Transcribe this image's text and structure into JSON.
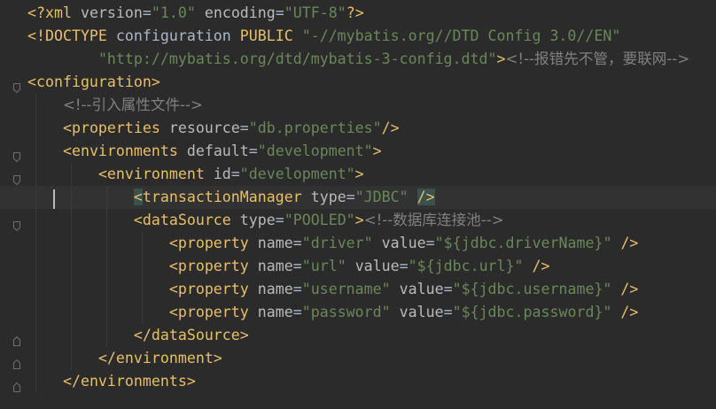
{
  "editor": {
    "language": "xml",
    "colors": {
      "background": "#2b2b2b",
      "tag": "#e8bf6a",
      "attribute": "#bababa",
      "value": "#6a8759",
      "comment": "#808080",
      "keyword": "#cc7832",
      "current_line": "#323232",
      "brace_match": "#3b514d"
    },
    "lines": [
      {
        "tokens": [
          {
            "t": "<?xml ",
            "c": "pi"
          },
          {
            "t": "version",
            "c": "attr"
          },
          {
            "t": "=",
            "c": "plain"
          },
          {
            "t": "\"1.0\"",
            "c": "val"
          },
          {
            "t": " ",
            "c": "plain"
          },
          {
            "t": "encoding",
            "c": "attr"
          },
          {
            "t": "=",
            "c": "plain"
          },
          {
            "t": "\"UTF-8\"",
            "c": "val"
          },
          {
            "t": "?>",
            "c": "pi"
          }
        ]
      },
      {
        "tokens": [
          {
            "t": "<!DOCTYPE ",
            "c": "doc"
          },
          {
            "t": "configuration ",
            "c": "plain"
          },
          {
            "t": "PUBLIC ",
            "c": "doc"
          },
          {
            "t": "\"-//mybatis.org//DTD Config 3.0//EN\"",
            "c": "val"
          }
        ]
      },
      {
        "tokens": [
          {
            "t": "        ",
            "c": "plain"
          },
          {
            "t": "\"http://mybatis.org/dtd/mybatis-3-config.dtd\"",
            "c": "val"
          },
          {
            "t": ">",
            "c": "doc"
          },
          {
            "t": "<!--报错先不管，要联网-->",
            "c": "com"
          }
        ]
      },
      {
        "tokens": [
          {
            "t": "<configuration>",
            "c": "tag"
          }
        ]
      },
      {
        "tokens": [
          {
            "t": "    ",
            "c": "plain"
          },
          {
            "t": "<!--引入属性文件-->",
            "c": "com"
          }
        ]
      },
      {
        "tokens": [
          {
            "t": "    ",
            "c": "plain"
          },
          {
            "t": "<properties ",
            "c": "tag"
          },
          {
            "t": "resource",
            "c": "attr"
          },
          {
            "t": "=",
            "c": "plain"
          },
          {
            "t": "\"db.properties\"",
            "c": "val"
          },
          {
            "t": "/>",
            "c": "tag"
          }
        ]
      },
      {
        "tokens": [
          {
            "t": "    ",
            "c": "plain"
          },
          {
            "t": "<environments ",
            "c": "tag"
          },
          {
            "t": "default",
            "c": "attr"
          },
          {
            "t": "=",
            "c": "plain"
          },
          {
            "t": "\"development\"",
            "c": "val"
          },
          {
            "t": ">",
            "c": "tag"
          }
        ]
      },
      {
        "tokens": [
          {
            "t": "        ",
            "c": "plain"
          },
          {
            "t": "<environment ",
            "c": "tag"
          },
          {
            "t": "id",
            "c": "attr"
          },
          {
            "t": "=",
            "c": "plain"
          },
          {
            "t": "\"development\"",
            "c": "val"
          },
          {
            "t": ">",
            "c": "tag"
          }
        ]
      },
      {
        "tokens": [
          {
            "t": "            ",
            "c": "plain"
          },
          {
            "t": "<",
            "c": "hl"
          },
          {
            "t": "transactionManager ",
            "c": "tag"
          },
          {
            "t": "type",
            "c": "attr"
          },
          {
            "t": "=",
            "c": "plain"
          },
          {
            "t": "\"JDBC\"",
            "c": "val"
          },
          {
            "t": " ",
            "c": "plain"
          },
          {
            "t": "/>",
            "c": "hl"
          }
        ]
      },
      {
        "tokens": [
          {
            "t": "            ",
            "c": "plain"
          },
          {
            "t": "<dataSource ",
            "c": "tag"
          },
          {
            "t": "type",
            "c": "attr"
          },
          {
            "t": "=",
            "c": "plain"
          },
          {
            "t": "\"POOLED\"",
            "c": "val"
          },
          {
            "t": ">",
            "c": "tag"
          },
          {
            "t": "<!--数据库连接池-->",
            "c": "com"
          }
        ]
      },
      {
        "tokens": [
          {
            "t": "                ",
            "c": "plain"
          },
          {
            "t": "<property ",
            "c": "tag"
          },
          {
            "t": "name",
            "c": "attr"
          },
          {
            "t": "=",
            "c": "plain"
          },
          {
            "t": "\"driver\"",
            "c": "val"
          },
          {
            "t": " ",
            "c": "plain"
          },
          {
            "t": "value",
            "c": "attr"
          },
          {
            "t": "=",
            "c": "plain"
          },
          {
            "t": "\"${jdbc.driverName}\"",
            "c": "val"
          },
          {
            "t": " ",
            "c": "plain"
          },
          {
            "t": "/>",
            "c": "tag"
          }
        ]
      },
      {
        "tokens": [
          {
            "t": "                ",
            "c": "plain"
          },
          {
            "t": "<property ",
            "c": "tag"
          },
          {
            "t": "name",
            "c": "attr"
          },
          {
            "t": "=",
            "c": "plain"
          },
          {
            "t": "\"url\"",
            "c": "val"
          },
          {
            "t": " ",
            "c": "plain"
          },
          {
            "t": "value",
            "c": "attr"
          },
          {
            "t": "=",
            "c": "plain"
          },
          {
            "t": "\"${jdbc.url}\"",
            "c": "val"
          },
          {
            "t": " ",
            "c": "plain"
          },
          {
            "t": "/>",
            "c": "tag"
          }
        ]
      },
      {
        "tokens": [
          {
            "t": "                ",
            "c": "plain"
          },
          {
            "t": "<property ",
            "c": "tag"
          },
          {
            "t": "name",
            "c": "attr"
          },
          {
            "t": "=",
            "c": "plain"
          },
          {
            "t": "\"username\"",
            "c": "val"
          },
          {
            "t": " ",
            "c": "plain"
          },
          {
            "t": "value",
            "c": "attr"
          },
          {
            "t": "=",
            "c": "plain"
          },
          {
            "t": "\"${jdbc.username}\"",
            "c": "val"
          },
          {
            "t": " ",
            "c": "plain"
          },
          {
            "t": "/>",
            "c": "tag"
          }
        ]
      },
      {
        "tokens": [
          {
            "t": "                ",
            "c": "plain"
          },
          {
            "t": "<property ",
            "c": "tag"
          },
          {
            "t": "name",
            "c": "attr"
          },
          {
            "t": "=",
            "c": "plain"
          },
          {
            "t": "\"password\"",
            "c": "val"
          },
          {
            "t": " ",
            "c": "plain"
          },
          {
            "t": "value",
            "c": "attr"
          },
          {
            "t": "=",
            "c": "plain"
          },
          {
            "t": "\"${jdbc.password}\"",
            "c": "val"
          },
          {
            "t": " ",
            "c": "plain"
          },
          {
            "t": "/>",
            "c": "tag"
          }
        ]
      },
      {
        "tokens": [
          {
            "t": "            ",
            "c": "plain"
          },
          {
            "t": "</dataSource>",
            "c": "tag"
          }
        ]
      },
      {
        "tokens": [
          {
            "t": "        ",
            "c": "plain"
          },
          {
            "t": "</environment>",
            "c": "tag"
          }
        ]
      },
      {
        "tokens": [
          {
            "t": "    ",
            "c": "plain"
          },
          {
            "t": "</environments>",
            "c": "tag"
          }
        ]
      },
      {
        "tokens": []
      }
    ]
  }
}
